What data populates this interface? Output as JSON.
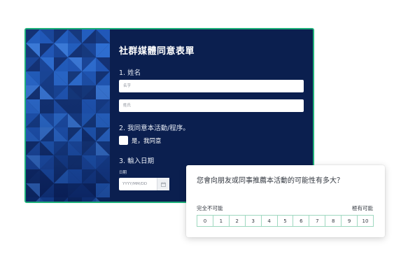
{
  "form": {
    "title": "社群媒體同意表單",
    "q1_label": "1. 姓名",
    "first_name_placeholder": "名字",
    "last_name_placeholder": "姓氏",
    "q2_label": "2. 我同意本活動/程序。",
    "consent_label": "是，我同意",
    "q3_label": "3. 輸入日期",
    "date_caption": "日期",
    "date_placeholder": "YYYY/MM/DD",
    "accent_color": "#1fb07a",
    "panel_color": "#0b1f4f",
    "calendar_icon": "calendar-icon"
  },
  "nps": {
    "question": "您會向朋友或同事推薦本活動的可能性有多大？",
    "low_label": "完全不可能",
    "high_label": "極有可能",
    "scale": [
      "0",
      "1",
      "2",
      "3",
      "4",
      "5",
      "6",
      "7",
      "8",
      "9",
      "10"
    ]
  }
}
